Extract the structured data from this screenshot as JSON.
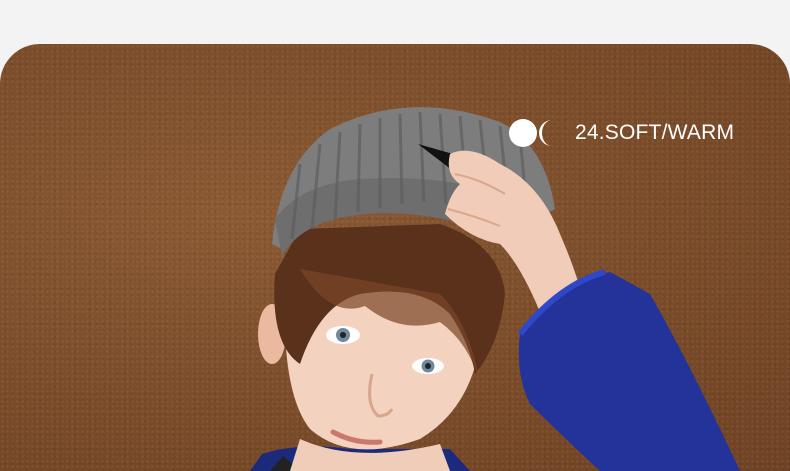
{
  "badge": {
    "text": "24.SOFT/WARM",
    "icon": "circle-crescent-icon"
  },
  "colors": {
    "page_background": "#f3f3f3",
    "backdrop": "#7a4c2a",
    "beanie": "#7b7b7b",
    "fleece": "#23339a",
    "badge_text": "#ffffff"
  }
}
